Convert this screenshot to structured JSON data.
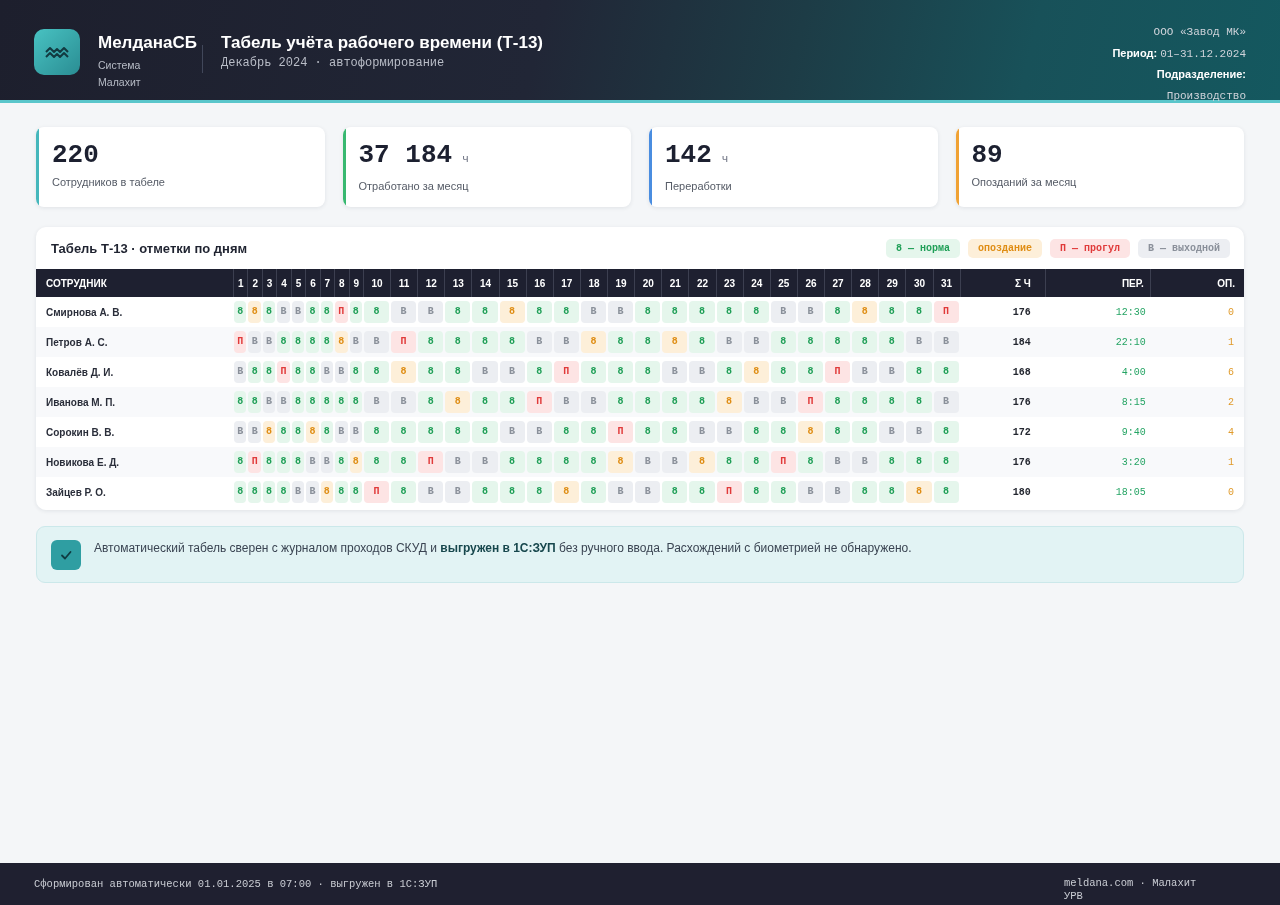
{
  "header": {
    "brand": {
      "name": "МелданаСБ",
      "subtitle": "Система Малахит"
    },
    "title": "Табель учёта рабочего времени (Т-13)",
    "subtitle": "Декабрь 2024 · автоформирование",
    "org": "ООО «Завод МК»",
    "period": {
      "label": "Период:",
      "value": "01–31.12.2024"
    },
    "department": {
      "label": "Подразделение:",
      "value": "Производство"
    }
  },
  "stats": [
    {
      "value": "220",
      "label": "Сотрудников в табеле",
      "color": "#45b7bc"
    },
    {
      "value": "37 184",
      "unit": "ч",
      "label": "Отработано за месяц",
      "color": "#38b870"
    },
    {
      "value": "142",
      "unit": "ч",
      "label": "Переработки",
      "color": "#4a8de0"
    },
    {
      "value": "89",
      "label": "Опозданий за месяц",
      "color": "#f0a234"
    }
  ],
  "timesheet": {
    "title": "Табель Т-13 · отметки по дням",
    "legend": [
      {
        "text": "8 — норма",
        "kind": "norm"
      },
      {
        "text": "опоздание",
        "kind": "late"
      },
      {
        "text": "П — прогул",
        "kind": "absent"
      },
      {
        "text": "В — выходной",
        "kind": "off"
      }
    ],
    "columns": {
      "employee": "СОТРУДНИК",
      "days": [
        "1",
        "2",
        "3",
        "4",
        "5",
        "6",
        "7",
        "8",
        "9",
        "10",
        "11",
        "12",
        "13",
        "14",
        "15",
        "16",
        "17",
        "18",
        "19",
        "20",
        "21",
        "22",
        "23",
        "24",
        "25",
        "26",
        "27",
        "28",
        "29",
        "30",
        "31"
      ],
      "total": "Σ Ч",
      "overtime": "ПЕР.",
      "late": "ОП."
    },
    "rows": [
      {
        "name": "Смирнова А. В.",
        "days": [
          {
            "mark": "8",
            "kind": "norm"
          },
          {
            "mark": "8",
            "kind": "late"
          },
          {
            "mark": "8",
            "kind": "norm"
          },
          {
            "mark": "В",
            "kind": "off"
          },
          {
            "mark": "В",
            "kind": "off"
          },
          {
            "mark": "8",
            "kind": "norm"
          },
          {
            "mark": "8",
            "kind": "norm"
          },
          {
            "mark": "П",
            "kind": "absent"
          },
          {
            "mark": "8",
            "kind": "norm"
          },
          {
            "mark": "8",
            "kind": "norm"
          },
          {
            "mark": "В",
            "kind": "off"
          },
          {
            "mark": "В",
            "kind": "off"
          },
          {
            "mark": "8",
            "kind": "norm"
          },
          {
            "mark": "8",
            "kind": "norm"
          },
          {
            "mark": "8",
            "kind": "late"
          },
          {
            "mark": "8",
            "kind": "norm"
          },
          {
            "mark": "8",
            "kind": "norm"
          },
          {
            "mark": "В",
            "kind": "off"
          },
          {
            "mark": "В",
            "kind": "off"
          },
          {
            "mark": "8",
            "kind": "norm"
          },
          {
            "mark": "8",
            "kind": "norm"
          },
          {
            "mark": "8",
            "kind": "norm"
          },
          {
            "mark": "8",
            "kind": "norm"
          },
          {
            "mark": "8",
            "kind": "norm"
          },
          {
            "mark": "В",
            "kind": "off"
          },
          {
            "mark": "В",
            "kind": "off"
          },
          {
            "mark": "8",
            "kind": "norm"
          },
          {
            "mark": "8",
            "kind": "late"
          },
          {
            "mark": "8",
            "kind": "norm"
          },
          {
            "mark": "8",
            "kind": "norm"
          },
          {
            "mark": "П",
            "kind": "absent"
          }
        ],
        "total": "176",
        "overtime": "12:30",
        "late": "0"
      },
      {
        "name": "Петров А. С.",
        "days": [
          {
            "mark": "П",
            "kind": "absent"
          },
          {
            "mark": "В",
            "kind": "off"
          },
          {
            "mark": "В",
            "kind": "off"
          },
          {
            "mark": "8",
            "kind": "norm"
          },
          {
            "mark": "8",
            "kind": "norm"
          },
          {
            "mark": "8",
            "kind": "norm"
          },
          {
            "mark": "8",
            "kind": "norm"
          },
          {
            "mark": "8",
            "kind": "late"
          },
          {
            "mark": "В",
            "kind": "off"
          },
          {
            "mark": "В",
            "kind": "off"
          },
          {
            "mark": "П",
            "kind": "absent"
          },
          {
            "mark": "8",
            "kind": "norm"
          },
          {
            "mark": "8",
            "kind": "norm"
          },
          {
            "mark": "8",
            "kind": "norm"
          },
          {
            "mark": "8",
            "kind": "norm"
          },
          {
            "mark": "В",
            "kind": "off"
          },
          {
            "mark": "В",
            "kind": "off"
          },
          {
            "mark": "8",
            "kind": "late"
          },
          {
            "mark": "8",
            "kind": "norm"
          },
          {
            "mark": "8",
            "kind": "norm"
          },
          {
            "mark": "8",
            "kind": "late"
          },
          {
            "mark": "8",
            "kind": "norm"
          },
          {
            "mark": "В",
            "kind": "off"
          },
          {
            "mark": "В",
            "kind": "off"
          },
          {
            "mark": "8",
            "kind": "norm"
          },
          {
            "mark": "8",
            "kind": "norm"
          },
          {
            "mark": "8",
            "kind": "norm"
          },
          {
            "mark": "8",
            "kind": "norm"
          },
          {
            "mark": "8",
            "kind": "norm"
          },
          {
            "mark": "В",
            "kind": "off"
          },
          {
            "mark": "В",
            "kind": "off"
          }
        ],
        "total": "184",
        "overtime": "22:10",
        "late": "1"
      },
      {
        "name": "Ковалёв Д. И.",
        "days": [
          {
            "mark": "В",
            "kind": "off"
          },
          {
            "mark": "8",
            "kind": "norm"
          },
          {
            "mark": "8",
            "kind": "norm"
          },
          {
            "mark": "П",
            "kind": "absent"
          },
          {
            "mark": "8",
            "kind": "norm"
          },
          {
            "mark": "8",
            "kind": "norm"
          },
          {
            "mark": "В",
            "kind": "off"
          },
          {
            "mark": "В",
            "kind": "off"
          },
          {
            "mark": "8",
            "kind": "norm"
          },
          {
            "mark": "8",
            "kind": "norm"
          },
          {
            "mark": "8",
            "kind": "late"
          },
          {
            "mark": "8",
            "kind": "norm"
          },
          {
            "mark": "8",
            "kind": "norm"
          },
          {
            "mark": "В",
            "kind": "off"
          },
          {
            "mark": "В",
            "kind": "off"
          },
          {
            "mark": "8",
            "kind": "norm"
          },
          {
            "mark": "П",
            "kind": "absent"
          },
          {
            "mark": "8",
            "kind": "norm"
          },
          {
            "mark": "8",
            "kind": "norm"
          },
          {
            "mark": "8",
            "kind": "norm"
          },
          {
            "mark": "В",
            "kind": "off"
          },
          {
            "mark": "В",
            "kind": "off"
          },
          {
            "mark": "8",
            "kind": "norm"
          },
          {
            "mark": "8",
            "kind": "late"
          },
          {
            "mark": "8",
            "kind": "norm"
          },
          {
            "mark": "8",
            "kind": "norm"
          },
          {
            "mark": "П",
            "kind": "absent"
          },
          {
            "mark": "В",
            "kind": "off"
          },
          {
            "mark": "В",
            "kind": "off"
          },
          {
            "mark": "8",
            "kind": "norm"
          },
          {
            "mark": "8",
            "kind": "norm"
          }
        ],
        "total": "168",
        "overtime": "4:00",
        "late": "6"
      },
      {
        "name": "Иванова М. П.",
        "days": [
          {
            "mark": "8",
            "kind": "norm"
          },
          {
            "mark": "8",
            "kind": "norm"
          },
          {
            "mark": "В",
            "kind": "off"
          },
          {
            "mark": "В",
            "kind": "off"
          },
          {
            "mark": "8",
            "kind": "norm"
          },
          {
            "mark": "8",
            "kind": "norm"
          },
          {
            "mark": "8",
            "kind": "norm"
          },
          {
            "mark": "8",
            "kind": "norm"
          },
          {
            "mark": "8",
            "kind": "norm"
          },
          {
            "mark": "В",
            "kind": "off"
          },
          {
            "mark": "В",
            "kind": "off"
          },
          {
            "mark": "8",
            "kind": "norm"
          },
          {
            "mark": "8",
            "kind": "late"
          },
          {
            "mark": "8",
            "kind": "norm"
          },
          {
            "mark": "8",
            "kind": "norm"
          },
          {
            "mark": "П",
            "kind": "absent"
          },
          {
            "mark": "В",
            "kind": "off"
          },
          {
            "mark": "В",
            "kind": "off"
          },
          {
            "mark": "8",
            "kind": "norm"
          },
          {
            "mark": "8",
            "kind": "norm"
          },
          {
            "mark": "8",
            "kind": "norm"
          },
          {
            "mark": "8",
            "kind": "norm"
          },
          {
            "mark": "8",
            "kind": "late"
          },
          {
            "mark": "В",
            "kind": "off"
          },
          {
            "mark": "В",
            "kind": "off"
          },
          {
            "mark": "П",
            "kind": "absent"
          },
          {
            "mark": "8",
            "kind": "norm"
          },
          {
            "mark": "8",
            "kind": "norm"
          },
          {
            "mark": "8",
            "kind": "norm"
          },
          {
            "mark": "8",
            "kind": "norm"
          },
          {
            "mark": "В",
            "kind": "off"
          }
        ],
        "total": "176",
        "overtime": "8:15",
        "late": "2"
      },
      {
        "name": "Сорокин В. В.",
        "days": [
          {
            "mark": "В",
            "kind": "off"
          },
          {
            "mark": "В",
            "kind": "off"
          },
          {
            "mark": "8",
            "kind": "late"
          },
          {
            "mark": "8",
            "kind": "norm"
          },
          {
            "mark": "8",
            "kind": "norm"
          },
          {
            "mark": "8",
            "kind": "late"
          },
          {
            "mark": "8",
            "kind": "norm"
          },
          {
            "mark": "В",
            "kind": "off"
          },
          {
            "mark": "В",
            "kind": "off"
          },
          {
            "mark": "8",
            "kind": "norm"
          },
          {
            "mark": "8",
            "kind": "norm"
          },
          {
            "mark": "8",
            "kind": "norm"
          },
          {
            "mark": "8",
            "kind": "norm"
          },
          {
            "mark": "8",
            "kind": "norm"
          },
          {
            "mark": "В",
            "kind": "off"
          },
          {
            "mark": "В",
            "kind": "off"
          },
          {
            "mark": "8",
            "kind": "norm"
          },
          {
            "mark": "8",
            "kind": "norm"
          },
          {
            "mark": "П",
            "kind": "absent"
          },
          {
            "mark": "8",
            "kind": "norm"
          },
          {
            "mark": "8",
            "kind": "norm"
          },
          {
            "mark": "В",
            "kind": "off"
          },
          {
            "mark": "В",
            "kind": "off"
          },
          {
            "mark": "8",
            "kind": "norm"
          },
          {
            "mark": "8",
            "kind": "norm"
          },
          {
            "mark": "8",
            "kind": "late"
          },
          {
            "mark": "8",
            "kind": "norm"
          },
          {
            "mark": "8",
            "kind": "norm"
          },
          {
            "mark": "В",
            "kind": "off"
          },
          {
            "mark": "В",
            "kind": "off"
          },
          {
            "mark": "8",
            "kind": "norm"
          }
        ],
        "total": "172",
        "overtime": "9:40",
        "late": "4"
      },
      {
        "name": "Новикова Е. Д.",
        "days": [
          {
            "mark": "8",
            "kind": "norm"
          },
          {
            "mark": "П",
            "kind": "absent"
          },
          {
            "mark": "8",
            "kind": "norm"
          },
          {
            "mark": "8",
            "kind": "norm"
          },
          {
            "mark": "8",
            "kind": "norm"
          },
          {
            "mark": "В",
            "kind": "off"
          },
          {
            "mark": "В",
            "kind": "off"
          },
          {
            "mark": "8",
            "kind": "norm"
          },
          {
            "mark": "8",
            "kind": "late"
          },
          {
            "mark": "8",
            "kind": "norm"
          },
          {
            "mark": "8",
            "kind": "norm"
          },
          {
            "mark": "П",
            "kind": "absent"
          },
          {
            "mark": "В",
            "kind": "off"
          },
          {
            "mark": "В",
            "kind": "off"
          },
          {
            "mark": "8",
            "kind": "norm"
          },
          {
            "mark": "8",
            "kind": "norm"
          },
          {
            "mark": "8",
            "kind": "norm"
          },
          {
            "mark": "8",
            "kind": "norm"
          },
          {
            "mark": "8",
            "kind": "late"
          },
          {
            "mark": "В",
            "kind": "off"
          },
          {
            "mark": "В",
            "kind": "off"
          },
          {
            "mark": "8",
            "kind": "late"
          },
          {
            "mark": "8",
            "kind": "norm"
          },
          {
            "mark": "8",
            "kind": "norm"
          },
          {
            "mark": "П",
            "kind": "absent"
          },
          {
            "mark": "8",
            "kind": "norm"
          },
          {
            "mark": "В",
            "kind": "off"
          },
          {
            "mark": "В",
            "kind": "off"
          },
          {
            "mark": "8",
            "kind": "norm"
          },
          {
            "mark": "8",
            "kind": "norm"
          },
          {
            "mark": "8",
            "kind": "norm"
          }
        ],
        "total": "176",
        "overtime": "3:20",
        "late": "1"
      },
      {
        "name": "Зайцев Р. О.",
        "days": [
          {
            "mark": "8",
            "kind": "norm"
          },
          {
            "mark": "8",
            "kind": "norm"
          },
          {
            "mark": "8",
            "kind": "norm"
          },
          {
            "mark": "8",
            "kind": "norm"
          },
          {
            "mark": "В",
            "kind": "off"
          },
          {
            "mark": "В",
            "kind": "off"
          },
          {
            "mark": "8",
            "kind": "late"
          },
          {
            "mark": "8",
            "kind": "norm"
          },
          {
            "mark": "8",
            "kind": "norm"
          },
          {
            "mark": "П",
            "kind": "absent"
          },
          {
            "mark": "8",
            "kind": "norm"
          },
          {
            "mark": "В",
            "kind": "off"
          },
          {
            "mark": "В",
            "kind": "off"
          },
          {
            "mark": "8",
            "kind": "norm"
          },
          {
            "mark": "8",
            "kind": "norm"
          },
          {
            "mark": "8",
            "kind": "norm"
          },
          {
            "mark": "8",
            "kind": "late"
          },
          {
            "mark": "8",
            "kind": "norm"
          },
          {
            "mark": "В",
            "kind": "off"
          },
          {
            "mark": "В",
            "kind": "off"
          },
          {
            "mark": "8",
            "kind": "norm"
          },
          {
            "mark": "8",
            "kind": "norm"
          },
          {
            "mark": "П",
            "kind": "absent"
          },
          {
            "mark": "8",
            "kind": "norm"
          },
          {
            "mark": "8",
            "kind": "norm"
          },
          {
            "mark": "В",
            "kind": "off"
          },
          {
            "mark": "В",
            "kind": "off"
          },
          {
            "mark": "8",
            "kind": "norm"
          },
          {
            "mark": "8",
            "kind": "norm"
          },
          {
            "mark": "8",
            "kind": "late"
          },
          {
            "mark": "8",
            "kind": "norm"
          }
        ],
        "total": "180",
        "overtime": "18:05",
        "late": "0"
      }
    ]
  },
  "note": {
    "text": "Автоматический табель сверен с журналом проходов СКУД и **выгружен в 1С:ЗУП** без ручного ввода. Расхождений с биометрией не обнаружено."
  },
  "footer": {
    "left": "Сформирован автоматически 01.01.2025 в 07:00 · выгружен в 1С:ЗУП",
    "right": "meldana.com · Малахит УРВ"
  }
}
